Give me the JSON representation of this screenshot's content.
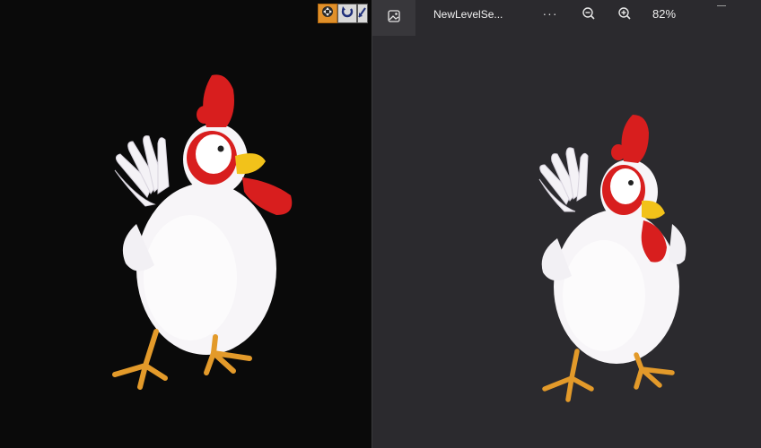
{
  "viewer": {
    "file_name": "NewLevelSe...",
    "more_label": "···",
    "zoom_level": "82%"
  },
  "colors": {
    "viewport_bg": "#0a0a0a",
    "viewer_bg": "#2b2a2e",
    "active_tool": "#e0902a",
    "chicken_comb": "#d81e1e",
    "chicken_beak": "#f2c21a",
    "chicken_feet": "#e39a2a"
  },
  "icons": {
    "move_tool": "move-icon",
    "rotate_tool": "rotate-icon",
    "scale_tool": "scale-icon",
    "gallery": "image-icon",
    "zoom_out": "zoom-out-icon",
    "zoom_in": "zoom-in-icon"
  }
}
